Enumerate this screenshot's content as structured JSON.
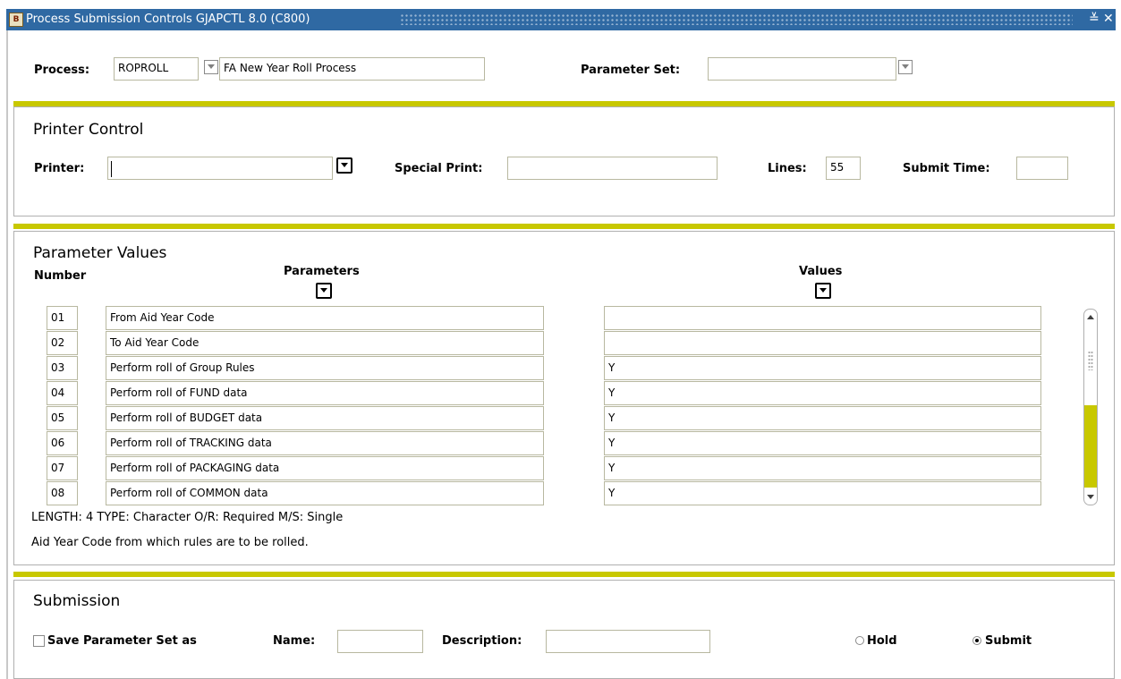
{
  "window": {
    "title": "Process Submission Controls  GJAPCTL  8.0  (C800)",
    "minimize_glyph": "≚",
    "close_glyph": "✕",
    "app_icon_glyph": "B"
  },
  "process": {
    "label": "Process:",
    "code": "ROPROLL",
    "description": "FA New Year Roll Process",
    "parameter_set_label": "Parameter Set:",
    "parameter_set_value": ""
  },
  "printer_control": {
    "title": "Printer Control",
    "printer_label": "Printer:",
    "printer_value": "",
    "special_print_label": "Special Print:",
    "special_print_value": "",
    "lines_label": "Lines:",
    "lines_value": "55",
    "submit_time_label": "Submit Time:",
    "submit_time_value": ""
  },
  "parameter_values": {
    "title": "Parameter Values",
    "number_header": "Number",
    "parameters_header": "Parameters",
    "values_header": "Values",
    "rows": [
      {
        "number": "01",
        "parameter": "From Aid Year Code",
        "value": ""
      },
      {
        "number": "02",
        "parameter": "To Aid Year Code",
        "value": ""
      },
      {
        "number": "03",
        "parameter": "Perform roll of Group Rules",
        "value": "Y"
      },
      {
        "number": "04",
        "parameter": "Perform roll of FUND data",
        "value": "Y"
      },
      {
        "number": "05",
        "parameter": "Perform roll of BUDGET data",
        "value": "Y"
      },
      {
        "number": "06",
        "parameter": "Perform roll of TRACKING data",
        "value": "Y"
      },
      {
        "number": "07",
        "parameter": "Perform roll of PACKAGING data",
        "value": "Y"
      },
      {
        "number": "08",
        "parameter": "Perform roll of COMMON data",
        "value": "Y"
      }
    ],
    "info_line": "LENGTH: 4 TYPE: Character O/R: Required M/S: Single",
    "help_line": "Aid Year Code from which rules are to be rolled."
  },
  "submission": {
    "title": "Submission",
    "save_label": "Save Parameter Set as",
    "save_checked": false,
    "name_label": "Name:",
    "name_value": "",
    "description_label": "Description:",
    "description_value": "",
    "hold_label": "Hold",
    "submit_label": "Submit",
    "selected": "Submit"
  },
  "colors": {
    "titlebar": "#2f69a3",
    "separator": "#c8c800",
    "scroll_thumb": "#c8c800"
  }
}
